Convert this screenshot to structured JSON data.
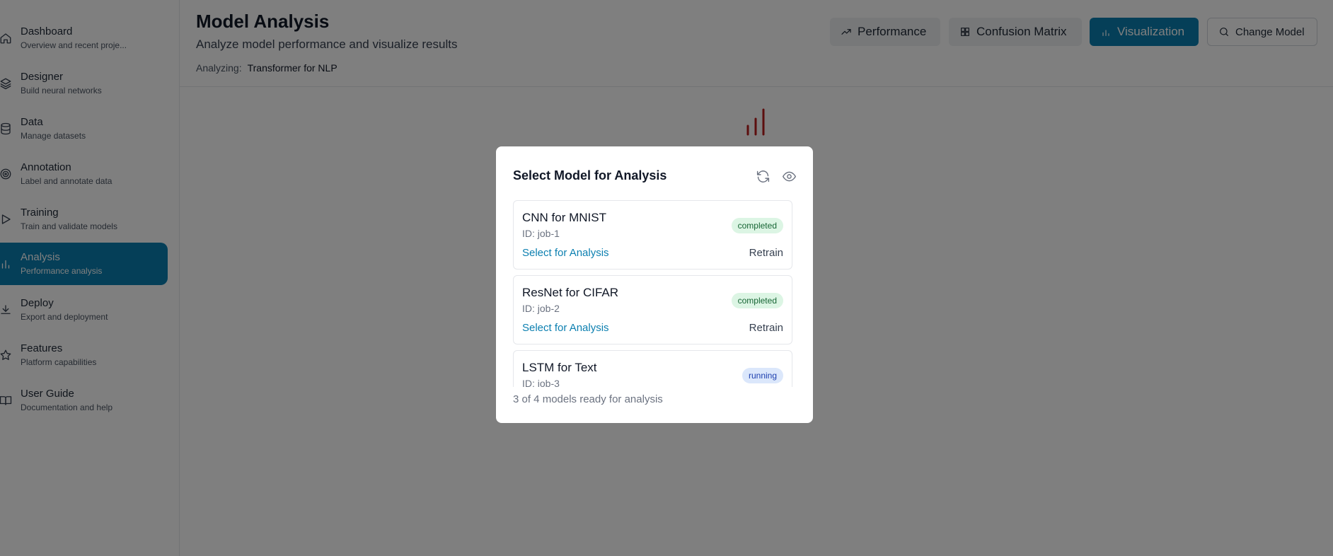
{
  "sidebar": {
    "items": [
      {
        "title": "Dashboard",
        "sub": "Overview and recent proje...",
        "icon": "home-icon"
      },
      {
        "title": "Designer",
        "sub": "Build neural networks",
        "icon": "layers-icon"
      },
      {
        "title": "Data",
        "sub": "Manage datasets",
        "icon": "database-icon"
      },
      {
        "title": "Annotation",
        "sub": "Label and annotate data",
        "icon": "target-icon"
      },
      {
        "title": "Training",
        "sub": "Train and validate models",
        "icon": "play-icon"
      },
      {
        "title": "Analysis",
        "sub": "Performance analysis",
        "icon": "bar-chart-icon",
        "active": true
      },
      {
        "title": "Deploy",
        "sub": "Export and deployment",
        "icon": "download-icon"
      },
      {
        "title": "Features",
        "sub": "Platform capabilities",
        "icon": "star-icon"
      },
      {
        "title": "User Guide",
        "sub": "Documentation and help",
        "icon": "book-icon"
      }
    ]
  },
  "header": {
    "title": "Model Analysis",
    "subtitle": "Analyze model performance and visualize results",
    "analyzing_label": "Analyzing:",
    "analyzing_model": "Transformer for NLP",
    "buttons": {
      "performance": "Performance",
      "confusion": "Confusion Matrix",
      "visualization": "Visualization",
      "change_model": "Change Model"
    }
  },
  "modal": {
    "title": "Select Model for Analysis",
    "models": [
      {
        "name": "CNN for MNIST",
        "id": "ID: job-1",
        "status": "completed",
        "select": "Select for Analysis",
        "retrain": "Retrain"
      },
      {
        "name": "ResNet for CIFAR",
        "id": "ID: job-2",
        "status": "completed",
        "select": "Select for Analysis",
        "retrain": "Retrain"
      },
      {
        "name": "LSTM for Text",
        "id": "ID: job-3",
        "status": "running"
      }
    ],
    "footer": "3 of 4 models ready for analysis"
  },
  "colors": {
    "accent": "#0b7fb0",
    "chart_icon": "#b91c1c",
    "overlay": "rgba(0,0,0,0.5)"
  }
}
